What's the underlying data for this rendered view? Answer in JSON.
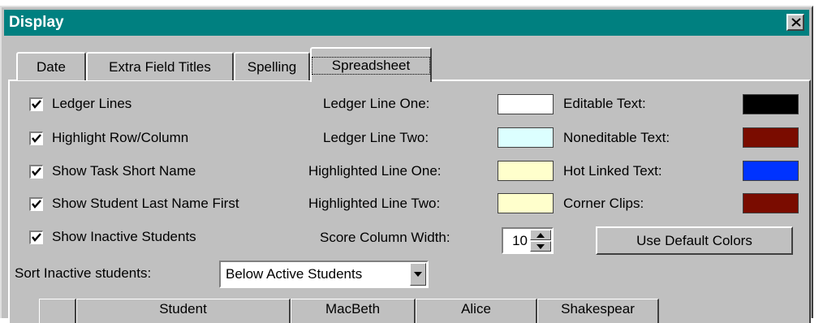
{
  "window": {
    "title": "Display"
  },
  "tabs": [
    {
      "label": "Date"
    },
    {
      "label": "Extra Field Titles"
    },
    {
      "label": "Spelling"
    },
    {
      "label": "Spreadsheet",
      "active": true
    }
  ],
  "options": [
    {
      "label": "Ledger Lines",
      "checked": true
    },
    {
      "label": "Highlight Row/Column",
      "checked": true
    },
    {
      "label": "Show Task Short Name",
      "checked": true
    },
    {
      "label": "Show Student Last Name First",
      "checked": true
    },
    {
      "label": "Show Inactive Students",
      "checked": true
    }
  ],
  "line_colors": [
    {
      "label": "Ledger Line One:",
      "color": "#ffffff"
    },
    {
      "label": "Ledger Line Two:",
      "color": "#dcffff"
    },
    {
      "label": "Highlighted Line One:",
      "color": "#ffffcc"
    },
    {
      "label": "Highlighted Line Two:",
      "color": "#ffffcc"
    }
  ],
  "text_colors": [
    {
      "label": "Editable Text:",
      "color": "#000000"
    },
    {
      "label": "Noneditable Text:",
      "color": "#7a0c00"
    },
    {
      "label": "Hot Linked Text:",
      "color": "#0033ff"
    },
    {
      "label": "Corner Clips:",
      "color": "#7a0c00"
    }
  ],
  "score_width": {
    "label": "Score Column Width:",
    "value": "10"
  },
  "default_colors_button": "Use Default Colors",
  "sort_inactive": {
    "label": "Sort Inactive students:",
    "value": "Below Active Students"
  },
  "preview_grid": {
    "columns": [
      "",
      "Student",
      "MacBeth",
      "Alice",
      "Shakespear"
    ]
  }
}
